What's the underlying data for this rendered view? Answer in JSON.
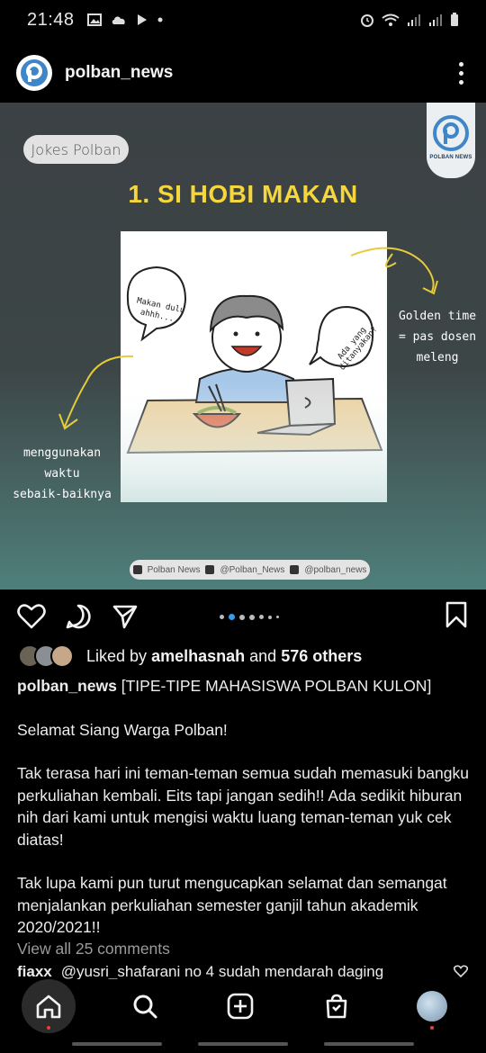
{
  "status_bar": {
    "time": "21:48"
  },
  "header": {
    "username": "polban_news",
    "avatar_icon": "polban-logo-icon"
  },
  "post_image": {
    "pill": "Jokes Polban",
    "brand": "POLBAN NEWS",
    "headline": "1. SI HOBI MAKAN",
    "speech_left": "Makan dulu ahhh...",
    "speech_right": "Ada yang ditanyakan?",
    "note_right": [
      "Golden time",
      "= pas dosen",
      "meleng"
    ],
    "note_left": [
      "menggunakan",
      "waktu",
      "sebaik-baiknya"
    ],
    "socials": [
      "Polban News",
      "@Polban_News",
      "@polban_news"
    ]
  },
  "carousel": {
    "count": 7,
    "active": 1
  },
  "likes": {
    "prefix": "Liked by",
    "user": "amelhasnah",
    "and": "and",
    "others": "576 others"
  },
  "caption": {
    "username": "polban_news",
    "title": "[TIPE-TIPE MAHASISWA POLBAN KULON]",
    "p1": "Selamat Siang Warga Polban!",
    "p2": "Tak terasa hari ini teman-teman semua sudah memasuki bangku perkuliahan kembali. Eits tapi jangan sedih!! Ada sedikit hiburan nih dari kami untuk mengisi waktu luang teman-teman yuk cek diatas!",
    "p3": "Tak lupa kami pun turut mengucapkan selamat dan semangat menjalankan perkuliahan semester ganjil tahun akademik 2020/2021!!"
  },
  "comments": {
    "view_all": "View all 25 comments",
    "first_user": "fiaxx",
    "first_text": "@yusri_shafarani no 4 sudah mendarah daging"
  },
  "colors": {
    "headline": "#f5d63d",
    "background": "#000000",
    "image_bg": "#3d4647"
  }
}
